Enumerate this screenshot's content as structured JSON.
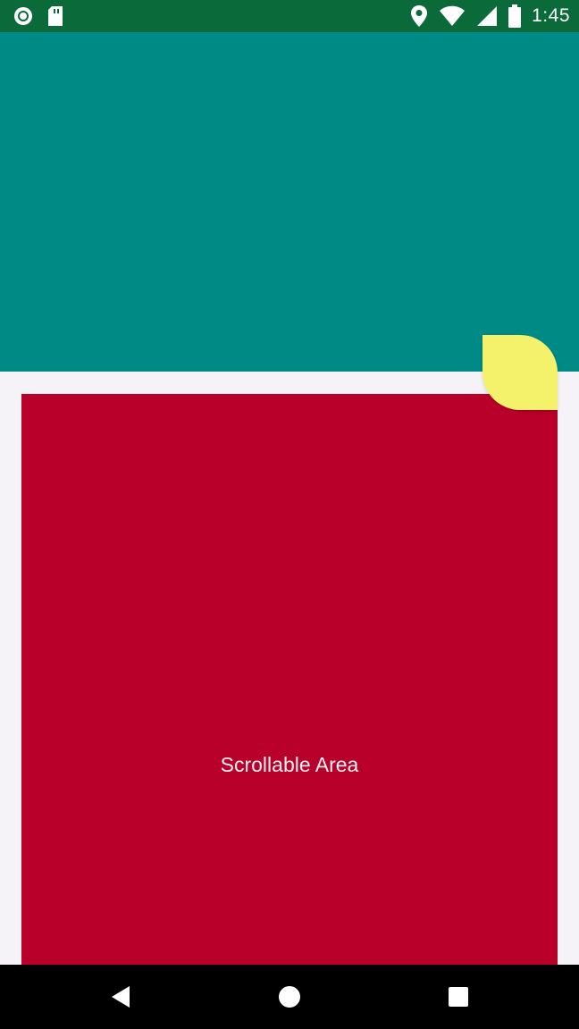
{
  "status_bar": {
    "time": "1:45",
    "left_icons": [
      "sync-circle-icon",
      "sd-card-icon"
    ],
    "right_icons": [
      "location-pin-icon",
      "wifi-icon",
      "cellular-signal-icon",
      "battery-icon"
    ],
    "color": "#0b6a3a"
  },
  "header": {
    "color": "#008a86"
  },
  "content": {
    "label": "Scrollable Area",
    "color": "#b8002a"
  },
  "fab": {
    "shape": "leaf",
    "color": "#f4f26a"
  },
  "nav_bar": {
    "buttons": [
      "back-icon",
      "home-icon",
      "recents-icon"
    ]
  }
}
